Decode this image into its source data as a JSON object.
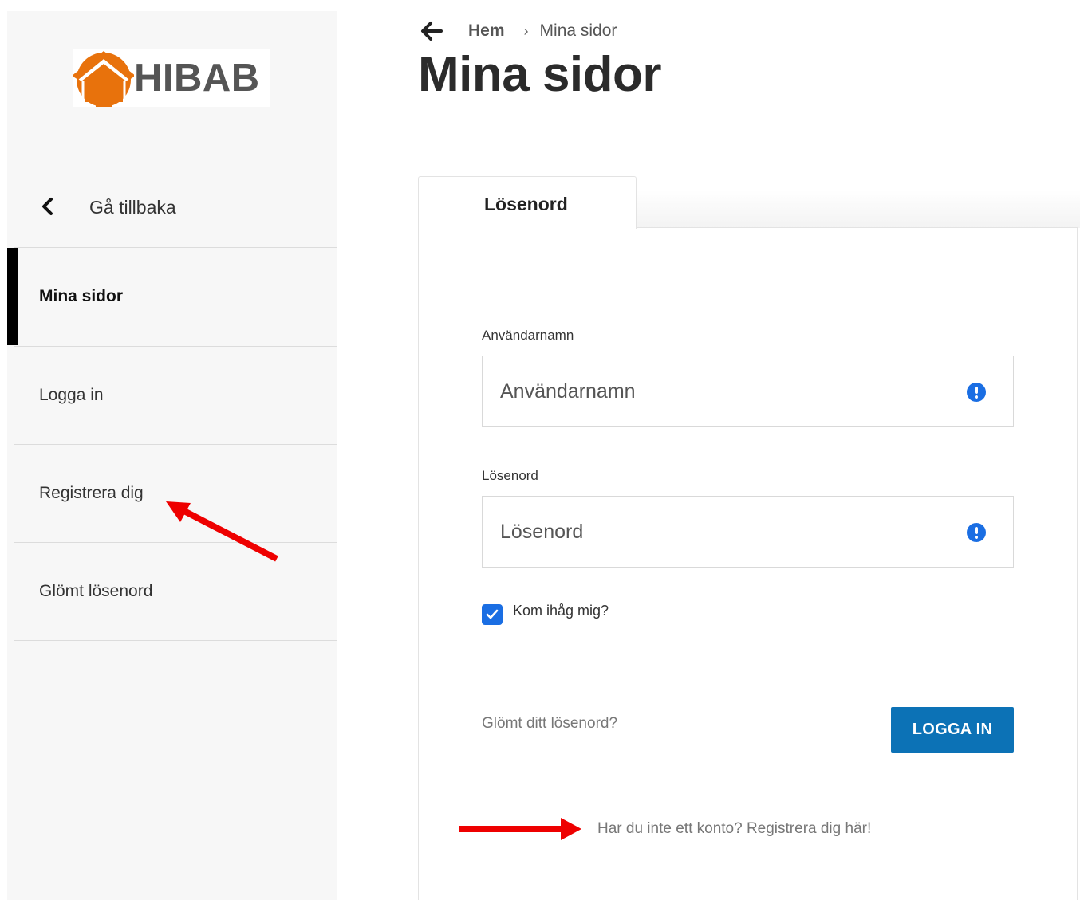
{
  "brand": {
    "logo_text": "HIBAB",
    "logo_color": "#e8720c"
  },
  "sidebar": {
    "back_label": "Gå tillbaka",
    "items": [
      {
        "label": "Mina sidor",
        "active": true
      },
      {
        "label": "Logga in",
        "active": false
      },
      {
        "label": "Registrera dig",
        "active": false
      },
      {
        "label": "Glömt lösenord",
        "active": false
      }
    ]
  },
  "breadcrumb": {
    "home": "Hem",
    "separator": "›",
    "current": "Mina sidor"
  },
  "page": {
    "title": "Mina sidor"
  },
  "tabs": [
    {
      "label": "Lösenord",
      "active": true
    }
  ],
  "form": {
    "username_label": "Användarnamn",
    "username_placeholder": "Användarnamn",
    "password_label": "Lösenord",
    "password_placeholder": "Lösenord",
    "remember_label": "Kom ihåg mig?",
    "remember_checked": true,
    "forgot_link": "Glömt ditt lösenord?",
    "login_button": "LOGGA IN",
    "register_link": "Har du inte ett konto? Registrera dig här!"
  },
  "colors": {
    "accent": "#0c72b6",
    "checkbox": "#1a6ee3",
    "warning_icon": "#1a6ee3",
    "annotation_arrow": "#ee0000"
  }
}
